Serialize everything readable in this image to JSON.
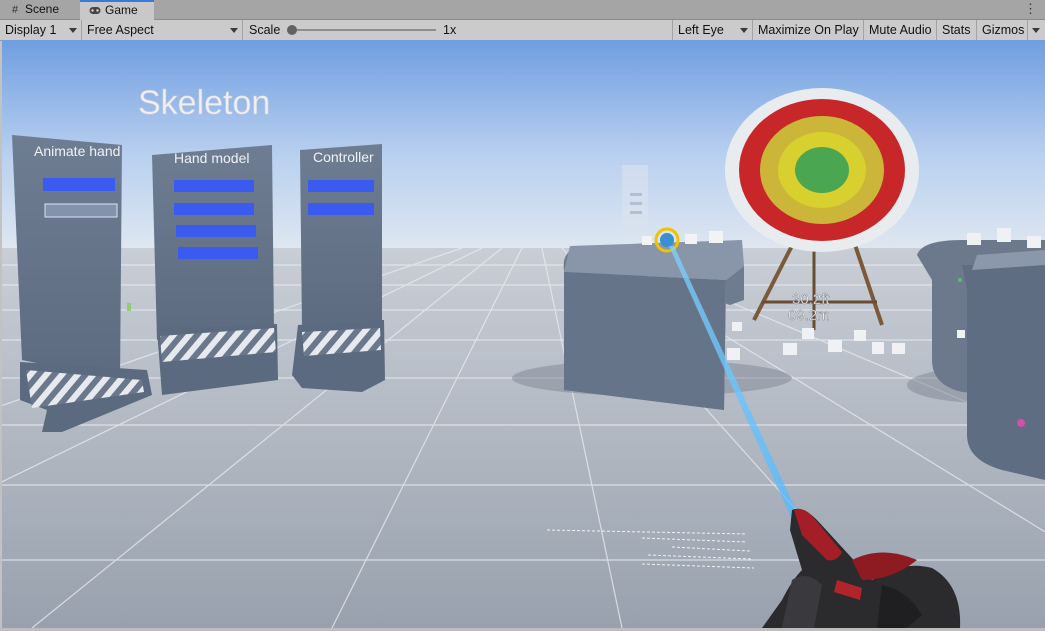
{
  "tabs": [
    {
      "label": "Scene",
      "icon": "grid-icon"
    },
    {
      "label": "Game",
      "icon": "gamepad-icon",
      "active": true
    }
  ],
  "toolbar": {
    "display": "Display 1",
    "aspect": "Free Aspect",
    "scale_label": "Scale",
    "scale_value": "1x",
    "eye": "Left Eye",
    "maximize": "Maximize On Play",
    "mute": "Mute Audio",
    "stats": "Stats",
    "gizmos": "Gizmos"
  },
  "scene": {
    "title": "Skeleton",
    "panels": {
      "animate": {
        "title": "Animate hand"
      },
      "hand_model": {
        "title": "Hand model"
      },
      "controller": {
        "title": "Controller"
      }
    },
    "target_distance": {
      "feet": "30.2ft",
      "meters": "09.2m"
    },
    "sky_top": "#6f9ee0",
    "floor_color": "#a9b1bd"
  }
}
